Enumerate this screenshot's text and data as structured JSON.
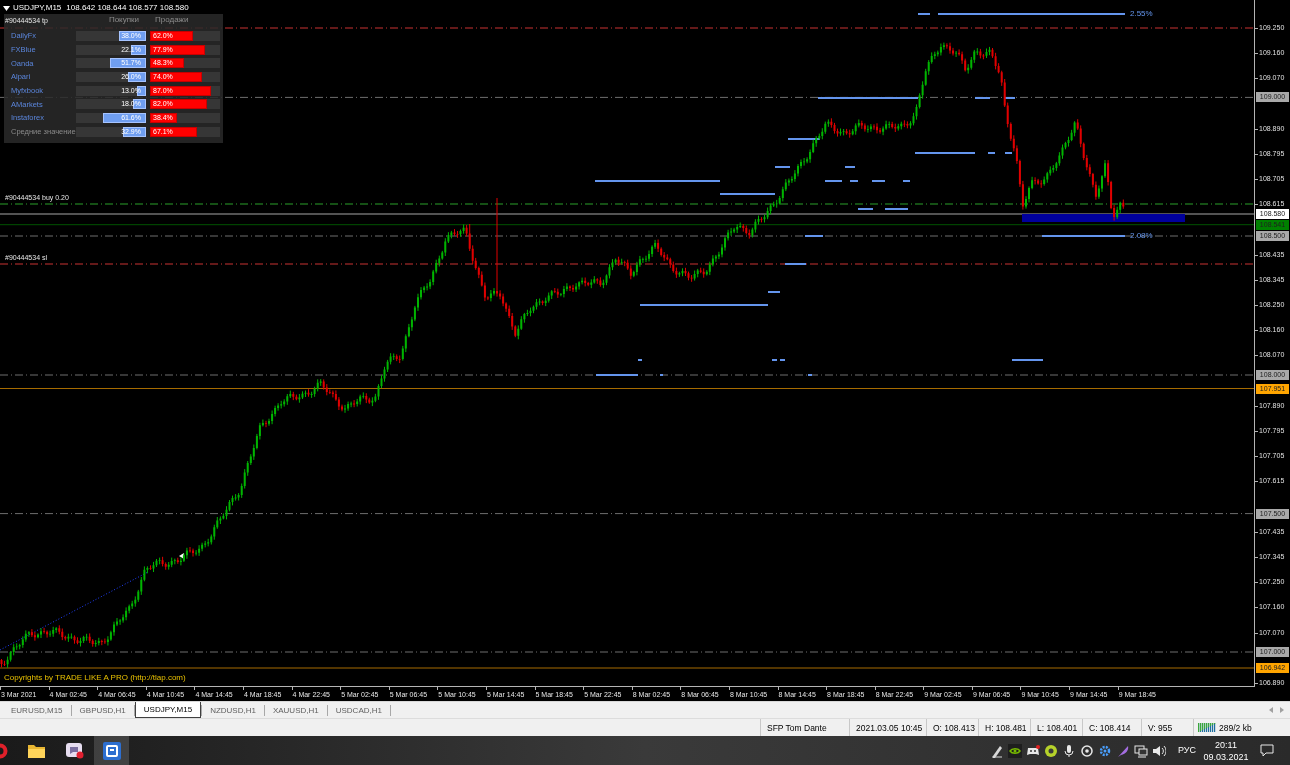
{
  "chart_window": {
    "title": "USDJPY,M15",
    "quote": "108.642 108.644 108.577 108.580"
  },
  "sentiment_panel": {
    "columns": [
      "Покупки",
      "Продажи"
    ],
    "rows": [
      {
        "name": "DailyFx",
        "kind": "broker",
        "buy": {
          "value": "38.0%",
          "level": 0.38
        },
        "sell": {
          "value": "62.0%",
          "level": 0.62
        }
      },
      {
        "name": "FXBlue",
        "kind": "broker",
        "buy": {
          "value": "22.1%",
          "level": 0.221
        },
        "sell": {
          "value": "77.9%",
          "level": 0.779
        }
      },
      {
        "name": "Oanda",
        "kind": "broker",
        "buy": {
          "value": "51.7%",
          "level": 0.517
        },
        "sell": {
          "value": "48.3%",
          "level": 0.483
        }
      },
      {
        "name": "Alpari",
        "kind": "broker",
        "buy": {
          "value": "26.0%",
          "level": 0.26
        },
        "sell": {
          "value": "74.0%",
          "level": 0.74
        }
      },
      {
        "name": "Myfxbook",
        "kind": "broker",
        "buy": {
          "value": "13.0%",
          "level": 0.13
        },
        "sell": {
          "value": "87.0%",
          "level": 0.87
        }
      },
      {
        "name": "AMarkets",
        "kind": "broker",
        "buy": {
          "value": "18.0%",
          "level": 0.18
        },
        "sell": {
          "value": "82.0%",
          "level": 0.82
        }
      },
      {
        "name": "Instaforex",
        "kind": "broker",
        "buy": {
          "value": "61.6%",
          "level": 0.616
        },
        "sell": {
          "value": "38.4%",
          "level": 0.384
        }
      },
      {
        "name": "Средние значение",
        "kind": "average",
        "buy": {
          "value": "32.9%",
          "level": 0.329
        },
        "sell": {
          "value": "67.1%",
          "level": 0.671
        }
      }
    ]
  },
  "trade_labels": [
    "#90444534 tp",
    "#90444534 buy 0.20",
    "#90444534 sl"
  ],
  "indicator_labels": [
    "2.55%",
    "2.08%"
  ],
  "copyright": "Copyrights by TRADE LIKE A PRO (http://tlap.com)",
  "price_axis": {
    "ticks": [
      "109.250",
      "109.160",
      "109.070",
      "108.890",
      "108.795",
      "108.705",
      "108.615",
      "108.435",
      "108.345",
      "108.250",
      "108.160",
      "108.070",
      "107.890",
      "107.795",
      "107.705",
      "107.615",
      "107.435",
      "107.345",
      "107.250",
      "107.160",
      "107.070",
      "106.890"
    ],
    "markers": [
      {
        "label": "109.000",
        "color": "#a9a9a9"
      },
      {
        "label": "108.580",
        "color": "#ffffff"
      },
      {
        "label": "108.541",
        "color": "#008000"
      },
      {
        "label": "108.500",
        "color": "#a9a9a9"
      },
      {
        "label": "108.000",
        "color": "#a9a9a9"
      },
      {
        "label": "107.951",
        "color": "#ffa500"
      },
      {
        "label": "107.500",
        "color": "#a9a9a9"
      },
      {
        "label": "107.000",
        "color": "#a9a9a9"
      },
      {
        "label": "106.942",
        "color": "#ffa500"
      }
    ]
  },
  "time_axis": {
    "labels": [
      "3 Mar 2021",
      "4 Mar 02:45",
      "4 Mar 06:45",
      "4 Mar 10:45",
      "4 Mar 14:45",
      "4 Mar 18:45",
      "4 Mar 22:45",
      "5 Mar 02:45",
      "5 Mar 06:45",
      "5 Mar 10:45",
      "5 Mar 14:45",
      "5 Mar 18:45",
      "5 Mar 22:45",
      "8 Mar 02:45",
      "8 Mar 06:45",
      "8 Mar 10:45",
      "8 Mar 14:45",
      "8 Mar 18:45",
      "8 Mar 22:45",
      "9 Mar 02:45",
      "9 Mar 06:45",
      "9 Mar 10:45",
      "9 Mar 14:45",
      "9 Mar 18:45"
    ]
  },
  "tabs": [
    {
      "label": "EURUSD,M15",
      "selected": false
    },
    {
      "label": "GBPUSD,H1",
      "selected": false
    },
    {
      "label": "USDJPY,M15",
      "selected": true
    },
    {
      "label": "NZDUSD,H1",
      "selected": false
    },
    {
      "label": "XAUUSD,H1",
      "selected": false
    },
    {
      "label": "USDCAD,H1",
      "selected": false
    }
  ],
  "status_bar": {
    "fields": [
      "SFP Tom Dante",
      "2021.03.05 10:45",
      "O: 108.413",
      "H: 108.481",
      "L: 108.401",
      "C: 108.414",
      "V: 955"
    ],
    "traffic": "289/2 kb"
  },
  "taskbar": {
    "apps": [
      {
        "selected": false
      },
      {
        "selected": false
      },
      {
        "selected": false
      },
      {
        "selected": true
      }
    ],
    "language": "РУС",
    "time": "20:11",
    "date": "09.03.2021"
  }
}
